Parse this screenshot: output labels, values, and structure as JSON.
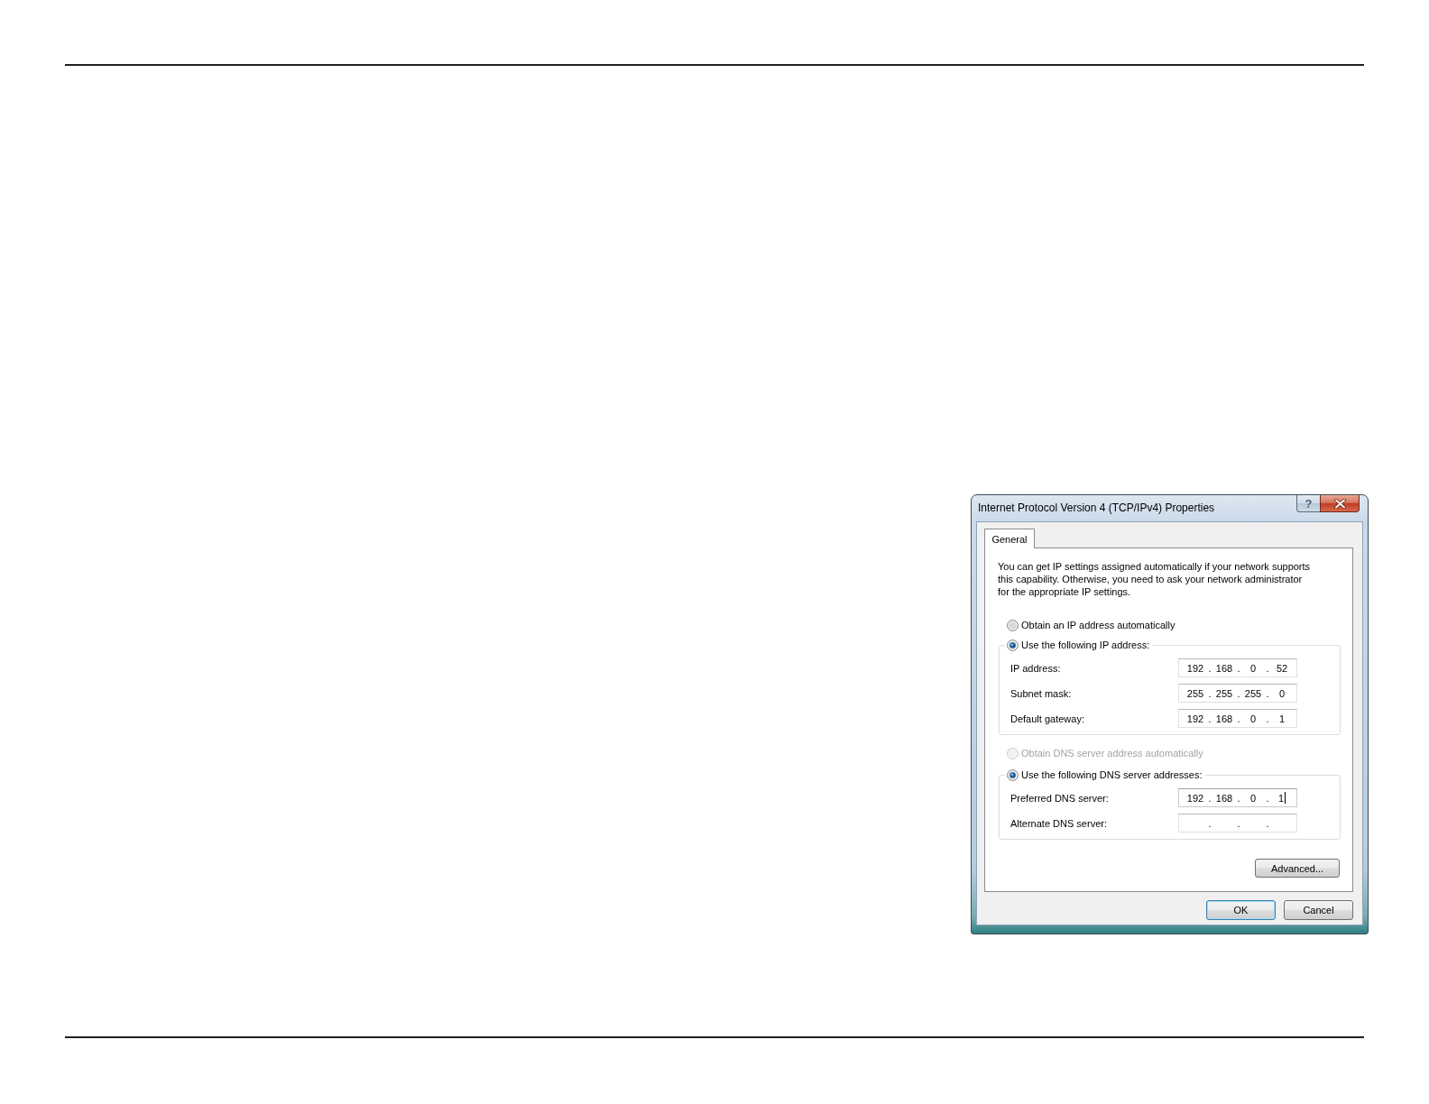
{
  "dialog": {
    "title": "Internet Protocol Version 4 (TCP/IPv4) Properties",
    "caption_buttons": [
      {
        "kind": "help",
        "glyph": "?"
      },
      {
        "kind": "close"
      }
    ],
    "tabs": [
      {
        "label": "General",
        "selected": true
      }
    ],
    "intro": "You can get IP settings assigned automatically if your network supports\nthis capability. Otherwise, you need to ask your network administrator\nfor the appropriate IP settings.",
    "sections": [
      {
        "kind": "radio",
        "label": "Obtain an IP address automatically",
        "selected": false,
        "disabled": false
      },
      {
        "kind": "group",
        "radio": {
          "label": "Use the following IP address:",
          "selected": true,
          "disabled": false
        },
        "fields": [
          {
            "label": "IP address:",
            "octets": [
              "192",
              "168",
              "0",
              "52"
            ],
            "dots": [
              ".",
              ".",
              "."
            ],
            "focused": false
          },
          {
            "label": "Subnet mask:",
            "octets": [
              "255",
              "255",
              "255",
              "0"
            ],
            "dots": [
              ".",
              ".",
              "."
            ],
            "focused": false
          },
          {
            "label": "Default gateway:",
            "octets": [
              "192",
              "168",
              "0",
              "1"
            ],
            "dots": [
              ".",
              ".",
              "."
            ],
            "focused": false
          }
        ]
      },
      {
        "kind": "radio",
        "label": "Obtain DNS server address automatically",
        "selected": false,
        "disabled": true
      },
      {
        "kind": "group",
        "radio": {
          "label": "Use the following DNS server addresses:",
          "selected": true,
          "disabled": false
        },
        "fields": [
          {
            "label": "Preferred DNS server:",
            "octets": [
              "192",
              "168",
              "0",
              "1"
            ],
            "dots": [
              ".",
              ".",
              "."
            ],
            "focused": true
          },
          {
            "label": "Alternate DNS server:",
            "dots": [
              ".",
              ".",
              "."
            ],
            "focused": false
          }
        ]
      }
    ],
    "advanced_button": {
      "label": "Advanced..."
    },
    "buttons": [
      {
        "label": "OK",
        "default": true
      },
      {
        "label": "Cancel",
        "default": false
      }
    ]
  }
}
